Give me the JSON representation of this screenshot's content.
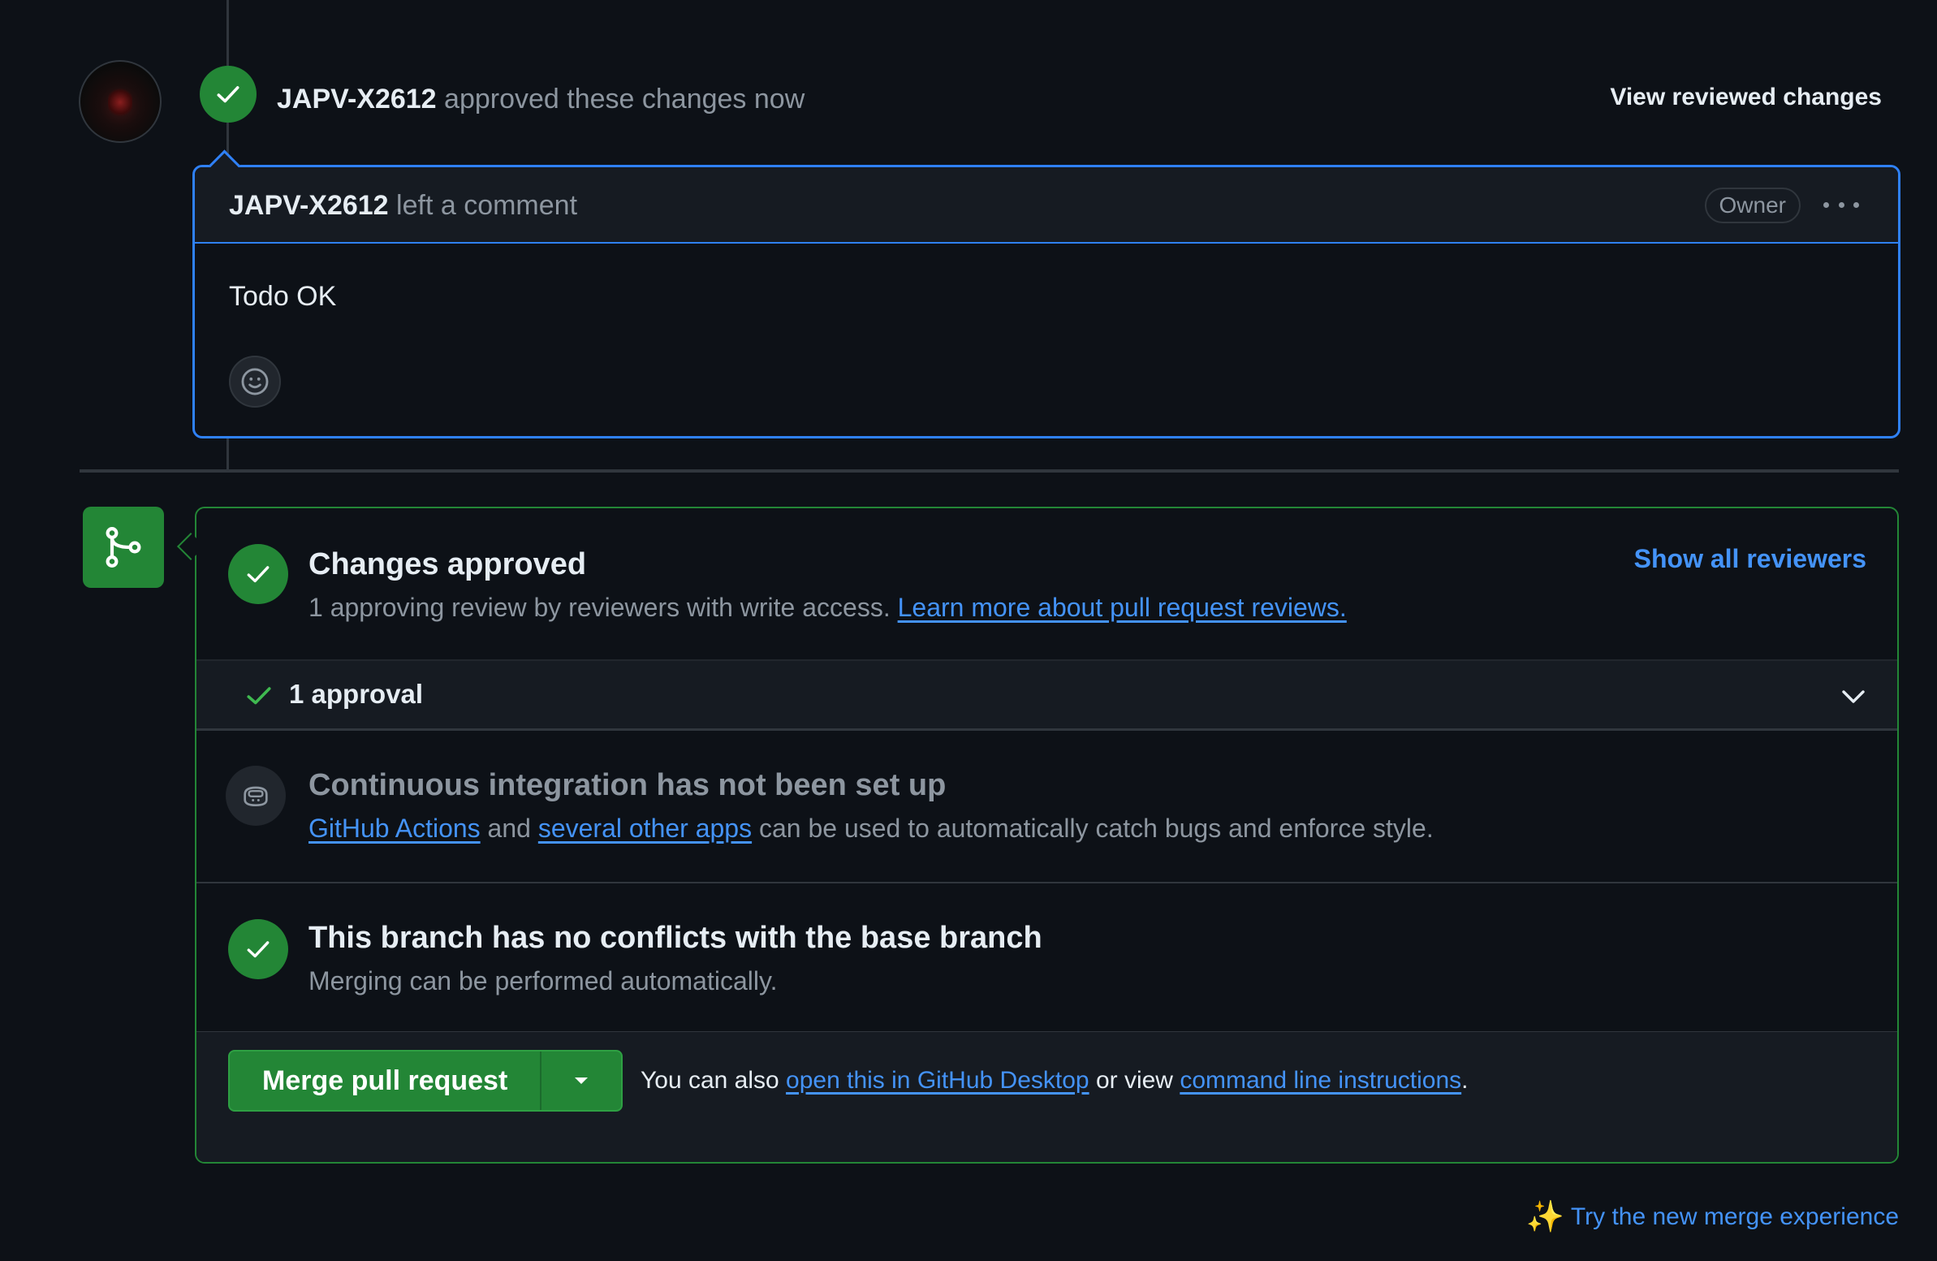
{
  "review_event": {
    "author": "JAPV-X2612",
    "action_text": "approved these changes now",
    "view_reviewed_label": "View reviewed changes"
  },
  "comment": {
    "author": "JAPV-X2612",
    "action_text": "left a comment",
    "role_badge": "Owner",
    "body": "Todo OK"
  },
  "merge_box": {
    "approved": {
      "title": "Changes approved",
      "subtitle": "1 approving review by reviewers with write access.",
      "learn_more_link": "Learn more about pull request reviews.",
      "show_all_reviewers": "Show all reviewers"
    },
    "approvals": {
      "label": "1 approval"
    },
    "ci": {
      "title": "Continuous integration has not been set up",
      "link_actions": "GitHub Actions",
      "and_text": "and",
      "link_other_apps": "several other apps",
      "rest_text": "can be used to automatically catch bugs and enforce style."
    },
    "conflicts": {
      "title": "This branch has no conflicts with the base branch",
      "subtitle": "Merging can be performed automatically."
    },
    "actions": {
      "merge_button": "Merge pull request",
      "also_prefix": "You can also",
      "desktop_link": "open this in GitHub Desktop",
      "or_view": "or view",
      "cli_link": "command line instructions",
      "period": "."
    }
  },
  "try_new_merge": "Try the new merge experience",
  "colors": {
    "background": "#0d1117",
    "success": "#238636",
    "accent_blue": "#2f81f7",
    "link": "#4493f8",
    "muted_text": "#8d96a0"
  }
}
